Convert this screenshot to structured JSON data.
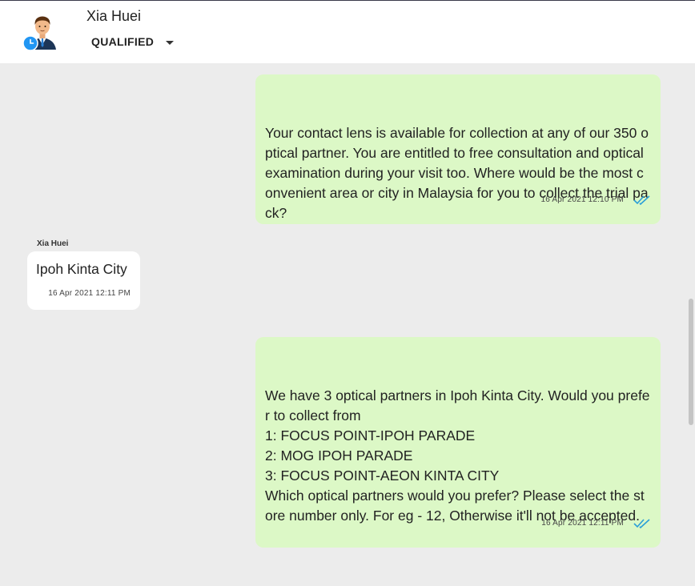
{
  "header": {
    "contact_name": "Xia Huei",
    "status": "QUALIFIED",
    "avatar_icon": "person-avatar-icon",
    "presence_icon": "clock-icon",
    "dropdown_icon": "caret-down-icon"
  },
  "messages": [
    {
      "direction": "outgoing",
      "text": "Your contact lens is available for collection at any of our 350 optical partner. You are entitled to free consultation and optical examination during your visit too. Where would be the most convenient area or city in Malaysia for you to collect the trial pack?",
      "time": "16 Apr 2021 12:10 PM",
      "status_icon": "double-check-icon"
    },
    {
      "direction": "incoming",
      "sender": "Xia Huei",
      "text": "Ipoh Kinta City",
      "time": "16 Apr 2021 12:11 PM"
    },
    {
      "direction": "outgoing",
      "text": "We have 3 optical partners in Ipoh Kinta City. Would you prefer to collect from\n1: FOCUS POINT-IPOH PARADE\n2: MOG IPOH PARADE\n3: FOCUS POINT-AEON KINTA CITY\nWhich optical partners would you prefer? Please select the store number only. For eg - 12, Otherwise it'll not be accepted.",
      "time": "16 Apr 2021 12:11 PM",
      "status_icon": "double-check-icon"
    }
  ],
  "colors": {
    "outgoing_bubble": "#dcf8c6",
    "incoming_bubble": "#ffffff",
    "chat_background": "#ececec",
    "read_ticks": "#2a9fd8",
    "presence_badge": "#2196f3"
  }
}
